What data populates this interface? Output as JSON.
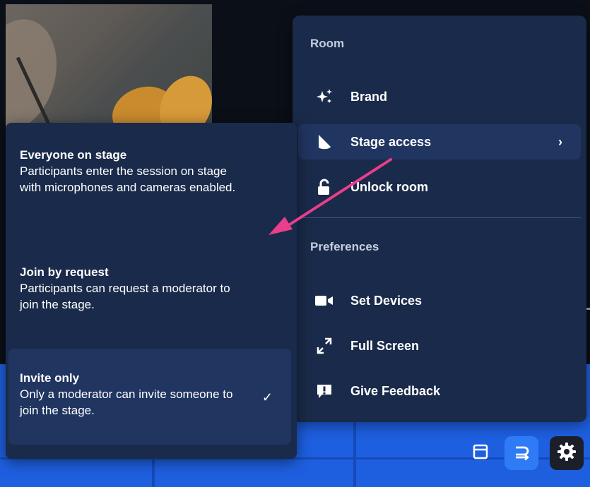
{
  "menu": {
    "room_title": "Room",
    "items": [
      {
        "label": "Brand",
        "icon": "sparkles-icon"
      },
      {
        "label": "Stage access",
        "icon": "stage-cone-icon",
        "submenu_indicator": "›"
      },
      {
        "label": "Unlock room",
        "icon": "unlock-icon"
      }
    ],
    "preferences_title": "Preferences",
    "pref_items": [
      {
        "label": "Set Devices",
        "icon": "camera-icon"
      },
      {
        "label": "Full Screen",
        "icon": "fullscreen-icon"
      },
      {
        "label": "Give Feedback",
        "icon": "feedback-icon"
      }
    ]
  },
  "stage_access": {
    "options": [
      {
        "title": "Everyone on stage",
        "description": "Participants enter the session on stage with microphones and cameras enabled.",
        "selected": false
      },
      {
        "title": "Join by request",
        "description": "Participants can request a moderator to join the stage.",
        "selected": false
      },
      {
        "title": "Invite only",
        "description": "Only a moderator can invite someone to join the stage.",
        "selected": true,
        "check": "✓"
      }
    ]
  },
  "toolbar": {
    "buttons": [
      {
        "icon": "layout-icon"
      },
      {
        "icon": "swap-icon",
        "active": true
      },
      {
        "icon": "gear-icon"
      }
    ]
  },
  "colors": {
    "menu_bg": "#1a2a4a",
    "active_item_bg": "#213561",
    "accent_blue": "#2f7bf5",
    "arrow_pink": "#e83e8c"
  }
}
